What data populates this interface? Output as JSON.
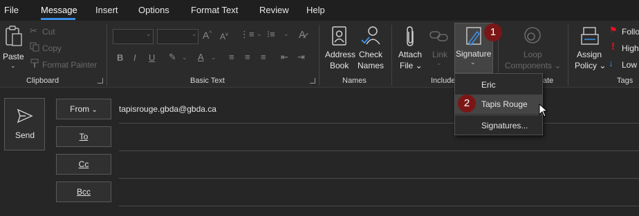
{
  "menu": {
    "items": [
      "File",
      "Message",
      "Insert",
      "Options",
      "Format Text",
      "Review",
      "Help"
    ],
    "active": "Message"
  },
  "clipboard": {
    "paste": "Paste",
    "cut": "Cut",
    "copy": "Copy",
    "format_painter": "Format Painter",
    "group_label": "Clipboard"
  },
  "basic_text": {
    "group_label": "Basic Text",
    "bold": "B",
    "italic": "I",
    "underline": "U",
    "grow_font": "A",
    "shrink_font": "A",
    "font_color": "A"
  },
  "names": {
    "address_book_1": "Address",
    "address_book_2": "Book",
    "check_names_1": "Check",
    "check_names_2": "Names",
    "group_label": "Names"
  },
  "include": {
    "attach_1": "Attach",
    "attach_2": "File",
    "link": "Link",
    "signature": "Signature",
    "group_label": "Include"
  },
  "loop": {
    "label_1": "Loop",
    "label_2": "Components",
    "group_label_fragment": "ate"
  },
  "tags": {
    "assign_1": "Assign",
    "assign_2": "Policy",
    "follow": "Follo",
    "high": "High",
    "low": "Low",
    "group_label": "Tags"
  },
  "callouts": {
    "one": "1",
    "two": "2"
  },
  "signature_menu": {
    "items": [
      "Eric",
      "Tapis Rouge",
      "Signatures..."
    ],
    "hovered": "Tapis Rouge"
  },
  "compose": {
    "send": "Send",
    "from_label": "From",
    "from_value": "tapisrouge.gbda@gbda.ca",
    "to_label": "To",
    "cc_label": "Cc",
    "bcc_label": "Bcc"
  },
  "colors": {
    "accent": "#3a8ee6",
    "badge": "#7b1616",
    "flag": "#e81123"
  }
}
